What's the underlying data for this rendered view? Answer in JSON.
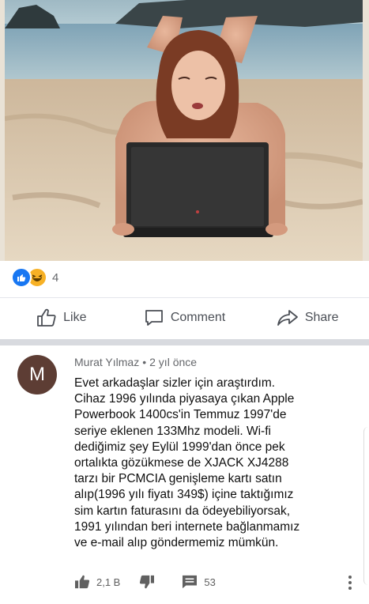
{
  "post": {
    "reaction_count": "4",
    "reaction_icons": [
      "like-icon",
      "haha-icon"
    ]
  },
  "actions": {
    "like_label": "Like",
    "comment_label": "Comment",
    "share_label": "Share"
  },
  "comment": {
    "avatar_letter": "M",
    "author": "Murat Yılmaz",
    "time": "2 yıl önce",
    "text": "Evet arkadaşlar sizler için araştırdım.\nCihaz 1996 yılında piyasaya çıkan Apple\nPowerbook 1400cs'in Temmuz 1997'de\nseriye eklenen 133Mhz modeli. Wi-fi\ndediğimiz şey Eylül 1999'dan önce pek\nortalıkta gözükmese de XJACK XJ4288\ntarzı bir PCMCIA genişleme kartı satın\nalıp(1996 yılı fiyatı 349$) içine taktığımız\nsim kartın faturasını da ödeyebiliyorsak,\n1991 yılından beri internete bağlanmamız\nve e-mail alıp göndermemiz mümkün.",
    "likes": "2,1 B",
    "replies": "53"
  },
  "colors": {
    "like_blue": "#1877f2",
    "haha_yellow": "#f7b125",
    "avatar_brown": "#5d3d34",
    "divider": "#d8dadf"
  }
}
